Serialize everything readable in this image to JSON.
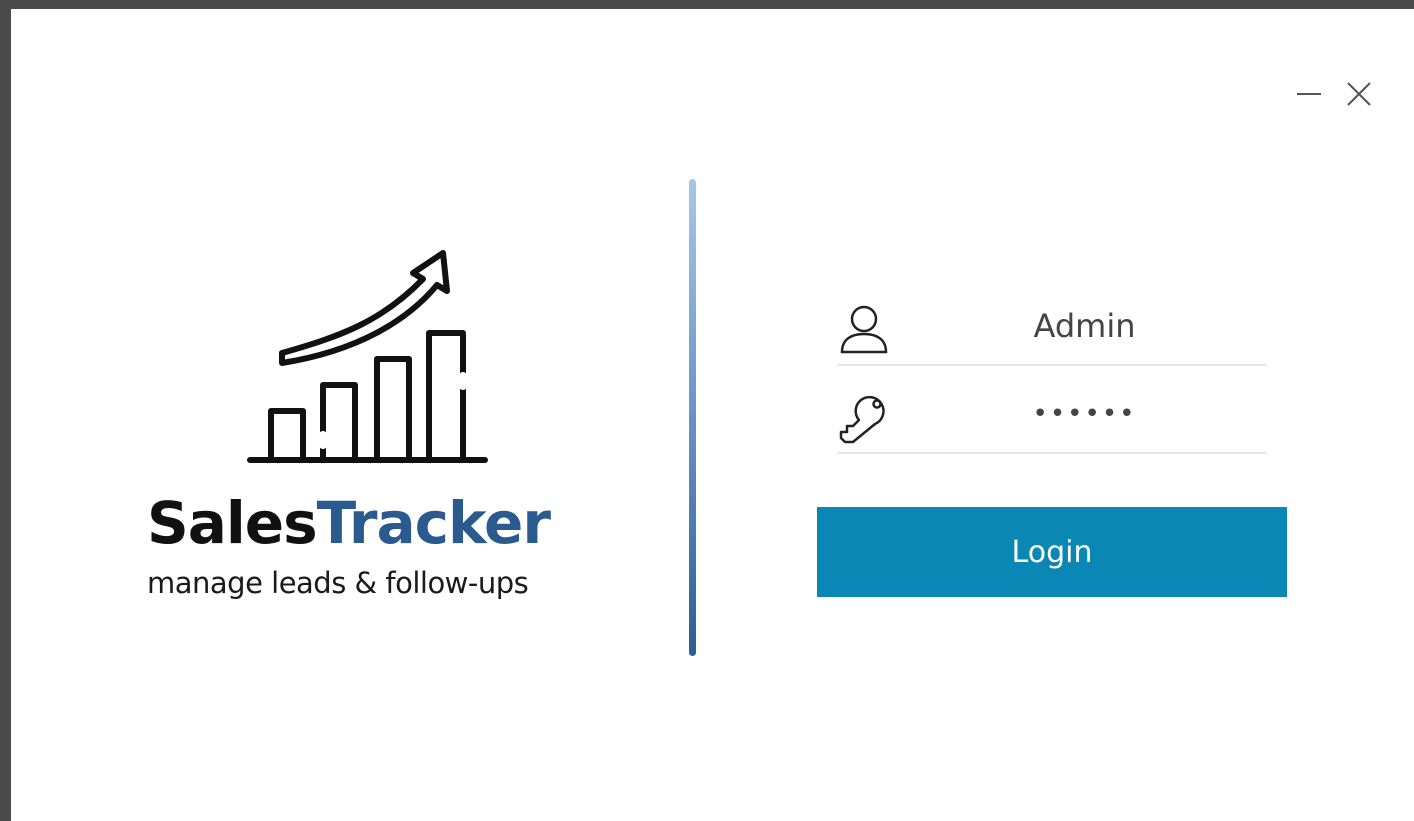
{
  "window": {
    "controls": {
      "minimize_icon": "minimize-icon",
      "close_icon": "close-icon"
    }
  },
  "branding": {
    "name_part1": "Sales",
    "name_part2": "Tracker",
    "tagline": "manage leads & follow-ups",
    "logo_icon": "growth-chart-icon",
    "colors": {
      "name_part1": "#111111",
      "name_part2": "#2a5a8e"
    }
  },
  "login_form": {
    "username": {
      "icon": "user-icon",
      "value": "Admin"
    },
    "password": {
      "icon": "key-icon",
      "value": "••••••"
    },
    "submit_label": "Login",
    "colors": {
      "button": "#0a87b5",
      "divider_top": "#a9c6e6",
      "divider_bottom": "#2e5e91"
    }
  }
}
